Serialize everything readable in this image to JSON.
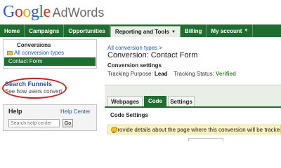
{
  "logo": {
    "letters": [
      "G",
      "o",
      "o",
      "g",
      "l",
      "e"
    ],
    "letter_colors": [
      "#2a5bd7",
      "#d62d20",
      "#f0a30a",
      "#2a5bd7",
      "#119a36",
      "#d62d20"
    ],
    "product": "AdWords"
  },
  "nav": {
    "items": [
      "Home",
      "Campaigns",
      "Opportunities",
      "Reporting and Tools",
      "Billing",
      "My account"
    ],
    "active": "Reporting and Tools"
  },
  "sidebar": {
    "tree_title": "Conversions",
    "all_link": "All conversion types",
    "selected": "Contact Form",
    "funnels_title": "Search Funnels",
    "funnels_sub": "See how users convert",
    "help_title": "Help",
    "help_center": "Help Center",
    "help_placeholder": "Search help center",
    "help_go": "Go"
  },
  "main": {
    "breadcrumb_link": "All conversion types",
    "breadcrumb_sep": ">",
    "title": "Conversion:  Contact Form",
    "settings_heading": "Conversion settings",
    "purpose_label": "Tracking Purpose:",
    "purpose_value": "Lead",
    "status_label": "Tracking Status:",
    "status_value": "Verified",
    "tabs": [
      "Webpages",
      "Code",
      "Settings"
    ],
    "active_tab": "Code",
    "code_settings": "Code Settings",
    "info_text": "Provide details about the page where this conversion will be tracked."
  },
  "colors": {
    "nav_green": "#1f6e2f",
    "link_blue": "#2255aa",
    "verified_green": "#3a8a2a",
    "highlight_red": "#cc2222",
    "info_yellow": "#fbf3c0"
  }
}
